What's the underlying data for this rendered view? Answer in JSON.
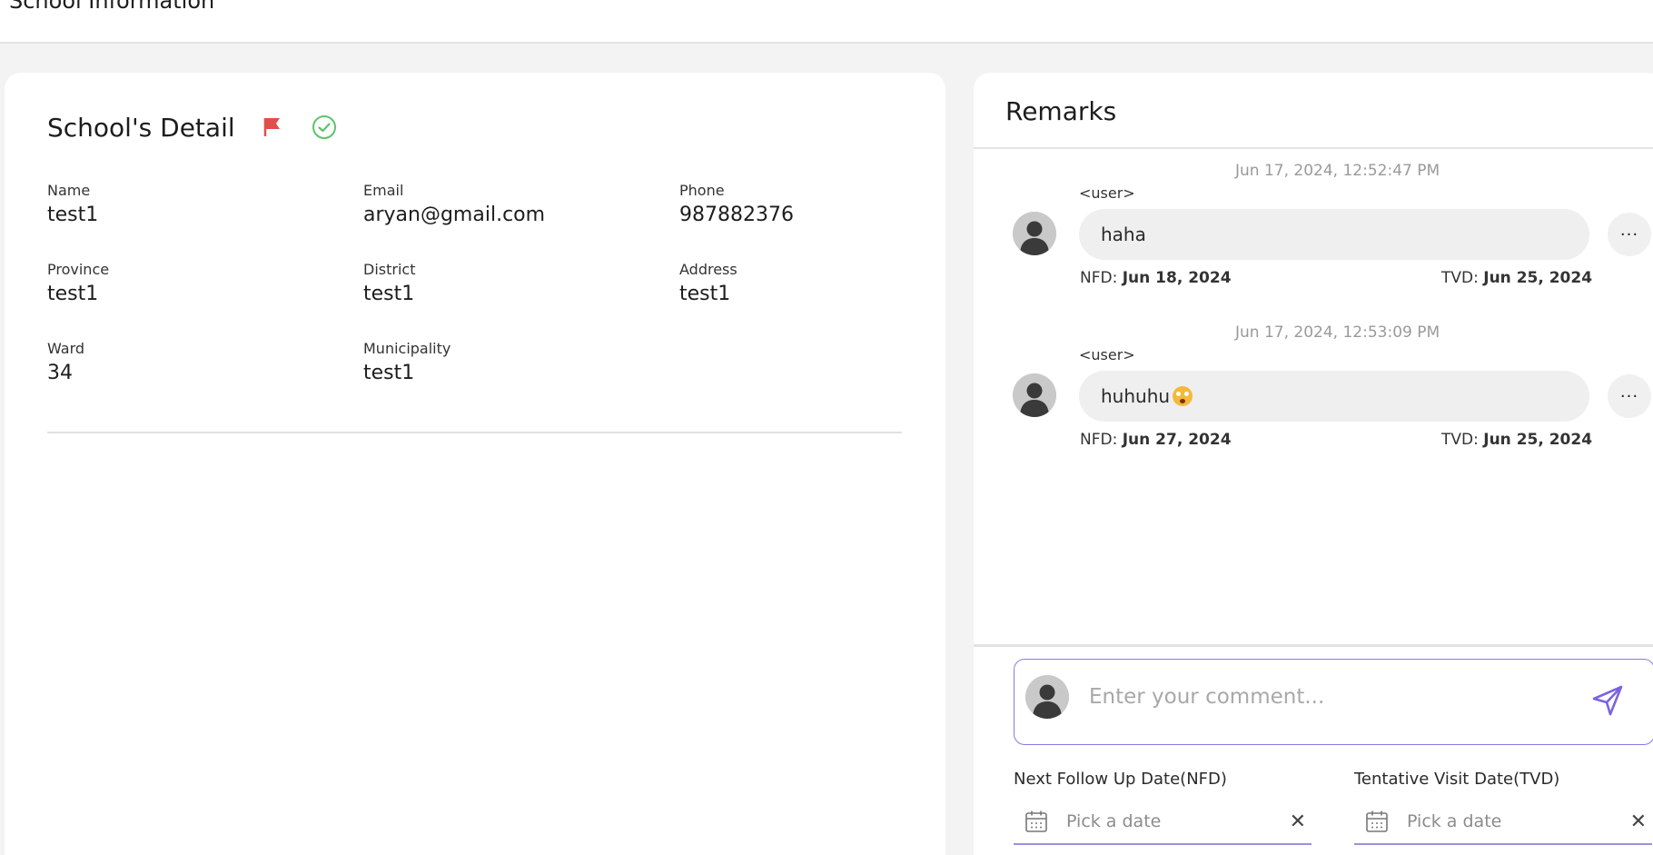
{
  "header": {
    "title": "School Information"
  },
  "school": {
    "title": "School's Detail",
    "fields": {
      "name": {
        "label": "Name",
        "value": "test1"
      },
      "email": {
        "label": "Email",
        "value": "aryan@gmail.com"
      },
      "phone": {
        "label": "Phone",
        "value": "987882376"
      },
      "province": {
        "label": "Province",
        "value": "test1"
      },
      "district": {
        "label": "District",
        "value": "test1"
      },
      "address": {
        "label": "Address",
        "value": "test1"
      },
      "ward": {
        "label": "Ward",
        "value": "34"
      },
      "municipality": {
        "label": "Municipality",
        "value": "test1"
      }
    },
    "status_colors": {
      "flag": "#e0504a",
      "verified": "#5cc46a"
    }
  },
  "remarks": {
    "title": "Remarks",
    "items": [
      {
        "timestamp": "Jun 17, 2024, 12:52:47 PM",
        "user": "<user>",
        "text": "haha",
        "nfd_label": "NFD:",
        "nfd": "Jun 18, 2024",
        "tvd_label": "TVD:",
        "tvd": "Jun 25, 2024",
        "more": "···"
      },
      {
        "timestamp": "Jun 17, 2024, 12:53:09 PM",
        "user": "<user>",
        "text": "huhuhu",
        "nfd_label": "NFD:",
        "nfd": "Jun 27, 2024",
        "tvd_label": "TVD:",
        "tvd": "Jun 25, 2024",
        "more": "···"
      }
    ],
    "comment": {
      "placeholder": "Enter your comment..."
    },
    "nfd_field": {
      "label": "Next Follow Up Date(NFD)",
      "placeholder": "Pick a date",
      "clear": "✕"
    },
    "tvd_field": {
      "label": "Tentative Visit Date(TVD)",
      "placeholder": "Pick a date",
      "clear": "✕"
    },
    "accent_color": "#7b63e0"
  }
}
